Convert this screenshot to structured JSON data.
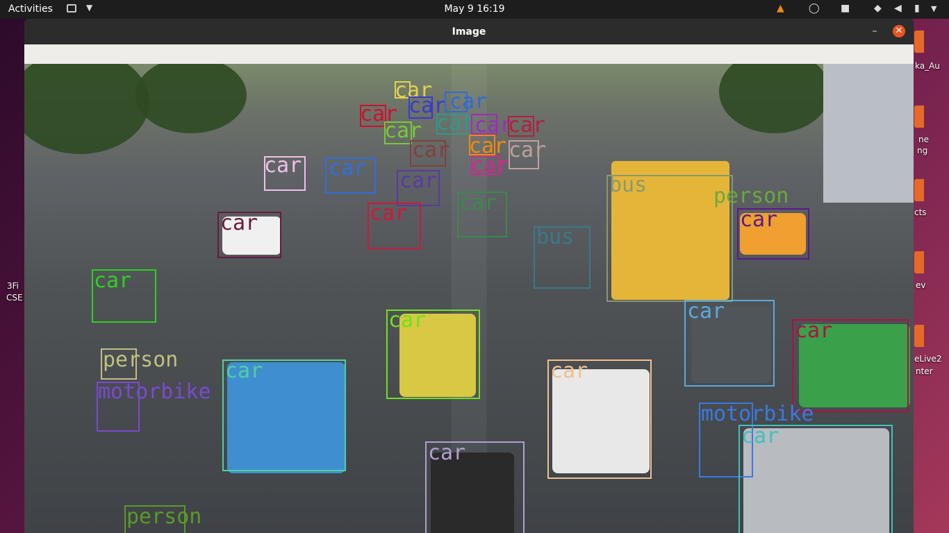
{
  "topbar": {
    "activities": "Activities",
    "clock": "May 9  16:19",
    "tray_icons": [
      "vlc-icon",
      "whatsapp-icon",
      "camera-icon",
      "wifi-icon",
      "volume-icon",
      "battery-icon",
      "chevron-down-icon"
    ]
  },
  "desktop": {
    "labels": [
      "ka_Au",
      "ne",
      "ng",
      "cts",
      "3Fi",
      "CSE",
      "ev",
      "eLive2",
      "nter"
    ]
  },
  "window": {
    "title": "Image",
    "minimize": "–",
    "close": "✕"
  },
  "detections": [
    {
      "label": "car",
      "color": "#e2d24e"
    },
    {
      "label": "car",
      "color": "#3a3ad0"
    },
    {
      "label": "car",
      "color": "#2f6ad8"
    },
    {
      "label": "car",
      "color": "#d0102a"
    },
    {
      "label": "car",
      "color": "#2e9a8a"
    },
    {
      "label": "car",
      "color": "#a02ac0"
    },
    {
      "label": "car",
      "color": "#b02040"
    },
    {
      "label": "car",
      "color": "#7ac83a"
    },
    {
      "label": "car",
      "color": "#804040"
    },
    {
      "label": "car",
      "color": "#f08a10"
    },
    {
      "label": "car",
      "color": "#c0a0a0"
    },
    {
      "label": "car",
      "color": "#d02890"
    },
    {
      "label": "car",
      "color": "#f0c0e8"
    },
    {
      "label": "car",
      "color": "#2e70e0"
    },
    {
      "label": "car",
      "color": "#5a3aa0"
    },
    {
      "label": "car",
      "color": "#d01838"
    },
    {
      "label": "car",
      "color": "#3a8a4a"
    },
    {
      "label": "car",
      "color": "#6a1a40"
    },
    {
      "label": "bus",
      "color": "#3a7a8a"
    },
    {
      "label": "bus",
      "color": "#8a9a6a"
    },
    {
      "label": "person",
      "color": "#6aaa3a"
    },
    {
      "label": "car",
      "color": "#5a1a8a"
    },
    {
      "label": "car",
      "color": "#30d020"
    },
    {
      "label": "car",
      "color": "#5aaae0"
    },
    {
      "label": "car",
      "color": "#b01040"
    },
    {
      "label": "car",
      "color": "#70e020"
    },
    {
      "label": "person",
      "color": "#c0c080"
    },
    {
      "label": "motorbike",
      "color": "#7a4ad0"
    },
    {
      "label": "car",
      "color": "#50d0a0"
    },
    {
      "label": "car",
      "color": "#f0c090"
    },
    {
      "label": "motorbike",
      "color": "#3a7ae0"
    },
    {
      "label": "car",
      "color": "#40c0c0"
    },
    {
      "label": "car",
      "color": "#b0a0d0"
    },
    {
      "label": "person",
      "color": "#5a9a2a"
    }
  ]
}
